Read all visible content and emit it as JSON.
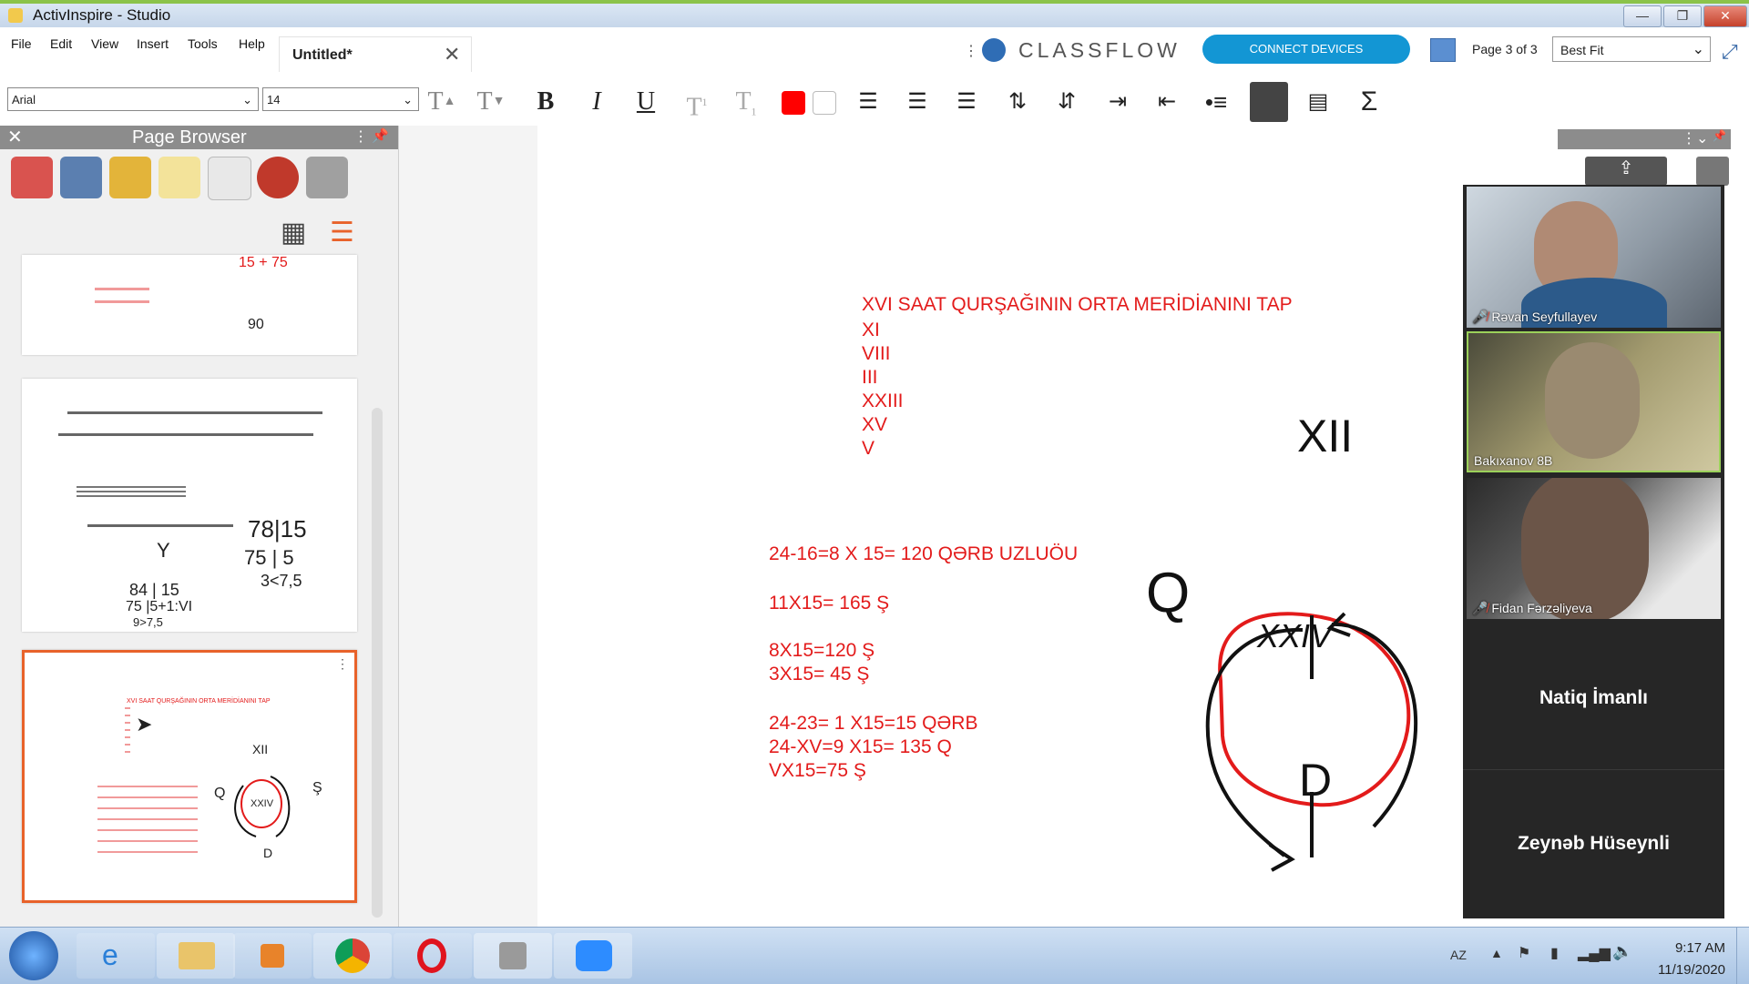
{
  "window": {
    "title": "ActivInspire - Studio"
  },
  "menu": [
    "File",
    "Edit",
    "View",
    "Insert",
    "Tools",
    "Help"
  ],
  "doc_tab": {
    "label": "Untitled*"
  },
  "classflow": {
    "brand": "CLASSFLOW",
    "connect_label": "CONNECT DEVICES"
  },
  "page_indicator": "Page 3 of 3",
  "zoom": {
    "value": "Best Fit"
  },
  "format": {
    "font": "Arial",
    "size": "14",
    "color_hex": "#ff0000"
  },
  "page_browser": {
    "title": "Page Browser"
  },
  "thumb1": {
    "text_top": "15 + 75",
    "text_bottom": "90"
  },
  "thumb2": {
    "big1": "78|15",
    "big2": "75 | 5",
    "big3": "3<7,5",
    "big4": "84 | 15",
    "big5": "75 |5+1:VI",
    "big6": "9>7,5",
    "letter": "Y"
  },
  "thumb3": {
    "title": "XVI SAAT QURŞAĞININ ORTA MERİDİANINI TAP",
    "top": "XII",
    "center": "XXIV",
    "left": "Q",
    "right": "Ş",
    "bottom": "D"
  },
  "canvas": {
    "title": "XVI SAAT QURŞAĞININ ORTA MERİDİANINI TAP",
    "list": [
      "XI",
      "VIII",
      "III",
      "XXIII",
      "XV",
      "V"
    ],
    "calc1": "24-16=8 X 15= 120 QƏRB UZLUÖU",
    "calc2": "11X15= 165 Ş",
    "calc3": "8X15=120 Ş",
    "calc4": "3X15= 45 Ş",
    "calc5": "24-23= 1 X15=15 QƏRB",
    "calc6": "24-XV=9 X15= 135 Q",
    "calc7": "VX15=75 Ş",
    "diagram": {
      "top": "XII",
      "center": "XXIV",
      "left": "Q",
      "bottom": "D"
    }
  },
  "zoom_call": {
    "participants": [
      "Rəvan Seyfullayev",
      "Bakıxanov 8B",
      "Fidan Fərzəliyeva"
    ],
    "names_only": [
      "Natiq İmanlı",
      "Zeynəb Hüseynli"
    ]
  },
  "taskbar": {
    "lang": "AZ",
    "time": "9:17 AM",
    "date": "11/19/2020"
  }
}
